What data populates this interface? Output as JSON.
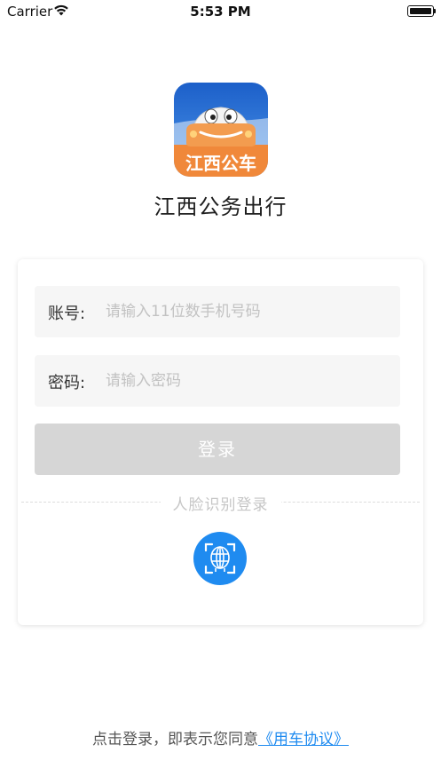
{
  "status_bar": {
    "carrier": "Carrier",
    "time": "5:53 PM",
    "icons": [
      "wifi-icon",
      "battery-icon"
    ]
  },
  "app": {
    "logo_text": "江西公车",
    "name": "江西公务出行"
  },
  "form": {
    "account_label": "账号:",
    "account_placeholder": "请输入11位数手机号码",
    "account_value": "",
    "password_label": "密码:",
    "password_placeholder": "请输入密码",
    "password_value": "",
    "login_button": "登录",
    "face_login_label": "人脸识别登录",
    "face_icon": "face-scan-icon"
  },
  "agreement": {
    "prefix": "点击登录，即表示您同意",
    "link": "《用车协议》"
  },
  "colors": {
    "accent": "#1f8bf0",
    "button_disabled": "#d6d6d6",
    "field_bg": "#f6f6f6",
    "logo_blue": "#2a6fd6",
    "logo_orange": "#f0883a"
  }
}
